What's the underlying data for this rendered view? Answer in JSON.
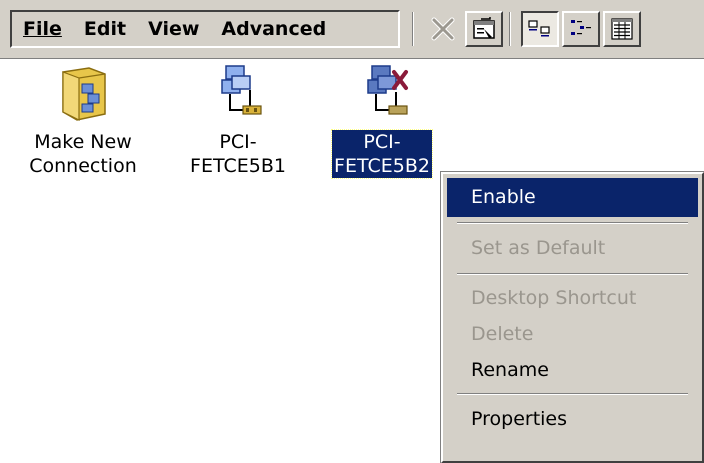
{
  "menubar": {
    "items": [
      {
        "label": "File"
      },
      {
        "label": "Edit"
      },
      {
        "label": "View"
      },
      {
        "label": "Advanced"
      }
    ]
  },
  "toolbar": {
    "buttons": [
      {
        "icon": "delete-icon",
        "state": "disabled"
      },
      {
        "icon": "properties-icon",
        "state": "normal"
      },
      {
        "icon": "large-icons-view-icon",
        "state": "pressed"
      },
      {
        "icon": "small-icons-view-icon",
        "state": "normal"
      },
      {
        "icon": "details-view-icon",
        "state": "normal"
      }
    ]
  },
  "icons": [
    {
      "label": "Make New\nConnection",
      "icon": "make-new-connection-icon",
      "selected": false
    },
    {
      "label": "PCI-\nFETCE5B1",
      "icon": "network-adapter-icon",
      "selected": false
    },
    {
      "label": "PCI-\nFETCE5B2",
      "icon": "network-adapter-disabled-icon",
      "selected": true
    }
  ],
  "context_menu": {
    "items": [
      {
        "label": "Enable",
        "state": "highlighted"
      },
      {
        "label": "Set as Default",
        "state": "disabled"
      },
      {
        "label": "Desktop Shortcut",
        "state": "disabled"
      },
      {
        "label": "Delete",
        "state": "disabled"
      },
      {
        "label": "Rename",
        "state": "enabled"
      },
      {
        "label": "Properties",
        "state": "enabled"
      }
    ]
  },
  "colors": {
    "chrome": "#d4d0c8",
    "selection": "#0a246a",
    "disabled_text": "#9a968e"
  }
}
